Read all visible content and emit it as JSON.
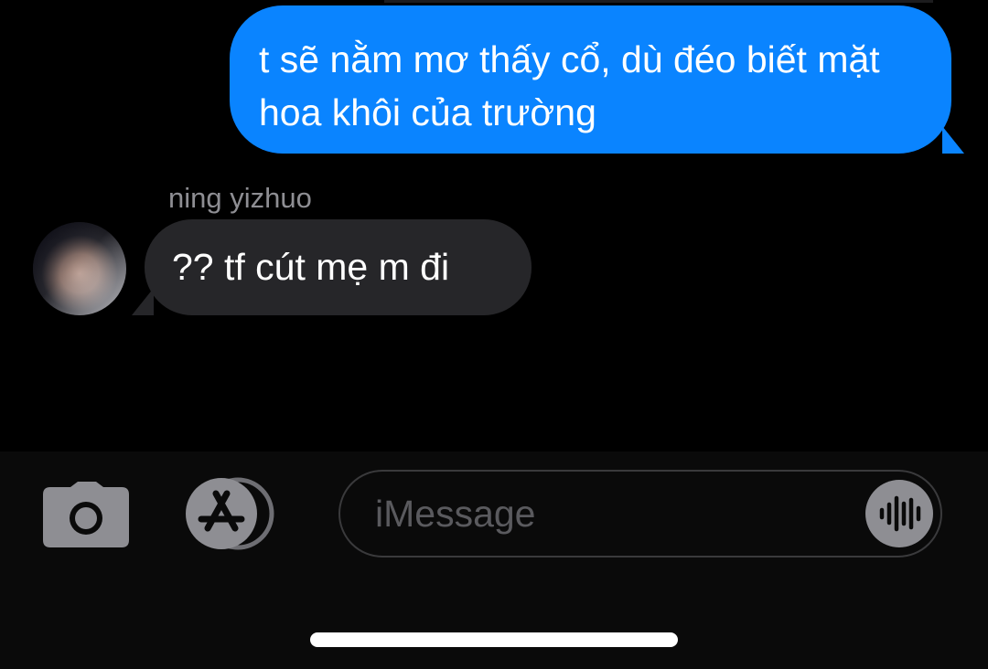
{
  "conversation": {
    "outgoing_message": "t sẽ nằm mơ thấy cổ, dù đéo biết mặt hoa khôi của trường",
    "incoming_sender": "ning yizhuo",
    "incoming_message": "?? tf cút mẹ m đi"
  },
  "composer": {
    "placeholder": "iMessage",
    "camera_icon": "camera-icon",
    "apps_icon": "app-store-icon",
    "audio_icon": "waveform-icon"
  },
  "colors": {
    "background": "#000000",
    "outgoing_bubble": "#0a84ff",
    "incoming_bubble": "#262629",
    "secondary_text": "#8e8e93",
    "icon_gray": "#8e8e93"
  }
}
